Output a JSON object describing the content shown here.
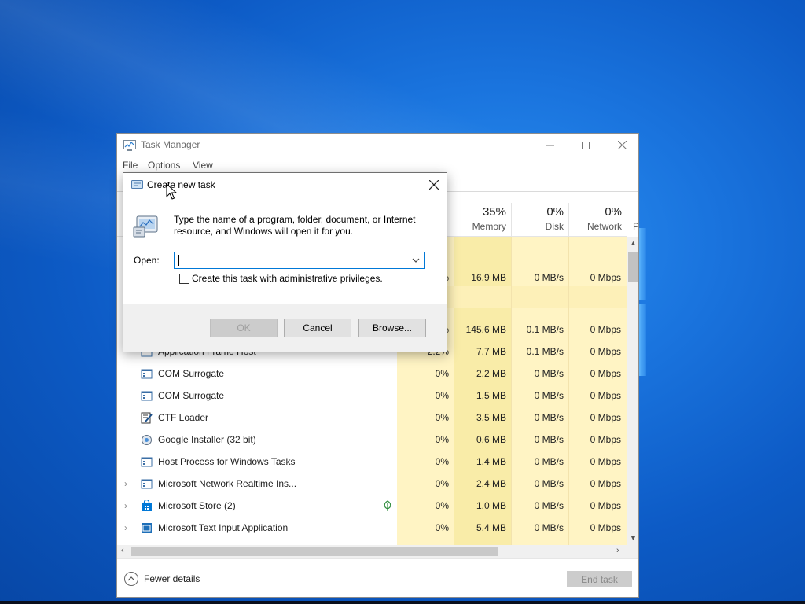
{
  "colors": {
    "accent": "#0078d7",
    "heat_light": "#fff4c4",
    "heat_medium": "#f9eca8",
    "desktop_blue": "#1a74de"
  },
  "task_manager": {
    "title": "Task Manager",
    "menu": [
      "File",
      "Options",
      "View"
    ],
    "columns": {
      "memory": {
        "percent": "35%",
        "label": "Memory"
      },
      "disk": {
        "percent": "0%",
        "label": "Disk"
      },
      "network": {
        "percent": "0%",
        "label": "Network"
      },
      "power_label_partial": "P"
    },
    "partial_rows": [
      {
        "cpu": "%",
        "memory": "16.9 MB",
        "disk": "0 MB/s",
        "network": "0 Mbps"
      },
      {
        "cpu": "%",
        "memory": "145.6 MB",
        "disk": "0.1 MB/s",
        "network": "0 Mbps"
      }
    ],
    "rows": [
      {
        "name": "Application Frame Host",
        "icon": "app-frame-icon",
        "expandable": false,
        "cells": [
          "2.2%",
          "7.7 MB",
          "0.1 MB/s",
          "0 Mbps"
        ]
      },
      {
        "name": "COM Surrogate",
        "icon": "window-app-icon",
        "expandable": false,
        "cells": [
          "0%",
          "2.2 MB",
          "0 MB/s",
          "0 Mbps"
        ]
      },
      {
        "name": "COM Surrogate",
        "icon": "window-app-icon",
        "expandable": false,
        "cells": [
          "0%",
          "1.5 MB",
          "0 MB/s",
          "0 Mbps"
        ]
      },
      {
        "name": "CTF Loader",
        "icon": "notepad-pen-icon",
        "expandable": false,
        "cells": [
          "0%",
          "3.5 MB",
          "0 MB/s",
          "0 Mbps"
        ]
      },
      {
        "name": "Google Installer (32 bit)",
        "icon": "installer-icon",
        "expandable": false,
        "cells": [
          "0%",
          "0.6 MB",
          "0 MB/s",
          "0 Mbps"
        ]
      },
      {
        "name": "Host Process for Windows Tasks",
        "icon": "window-app-icon",
        "expandable": false,
        "cells": [
          "0%",
          "1.4 MB",
          "0 MB/s",
          "0 Mbps"
        ]
      },
      {
        "name": "Microsoft Network Realtime Ins...",
        "icon": "window-app-icon",
        "expandable": true,
        "cells": [
          "0%",
          "2.4 MB",
          "0 MB/s",
          "0 Mbps"
        ]
      },
      {
        "name": "Microsoft Store (2)",
        "icon": "store-bag-icon",
        "expandable": true,
        "suspended_leaf": true,
        "cells": [
          "0%",
          "1.0 MB",
          "0 MB/s",
          "0 Mbps"
        ]
      },
      {
        "name": "Microsoft Text Input Application",
        "icon": "text-input-app-icon",
        "expandable": true,
        "cells": [
          "0%",
          "5.4 MB",
          "0 MB/s",
          "0 Mbps"
        ]
      }
    ],
    "fewer_details": "Fewer details",
    "end_task": "End task"
  },
  "dialog": {
    "title": "Create new task",
    "description": "Type the name of a program, folder, document, or Internet resource, and Windows will open it for you.",
    "open_label": "Open:",
    "open_value": "",
    "admin_checkbox_label": "Create this task with administrative privileges.",
    "admin_checked": false,
    "ok": "OK",
    "cancel": "Cancel",
    "browse": "Browse..."
  }
}
